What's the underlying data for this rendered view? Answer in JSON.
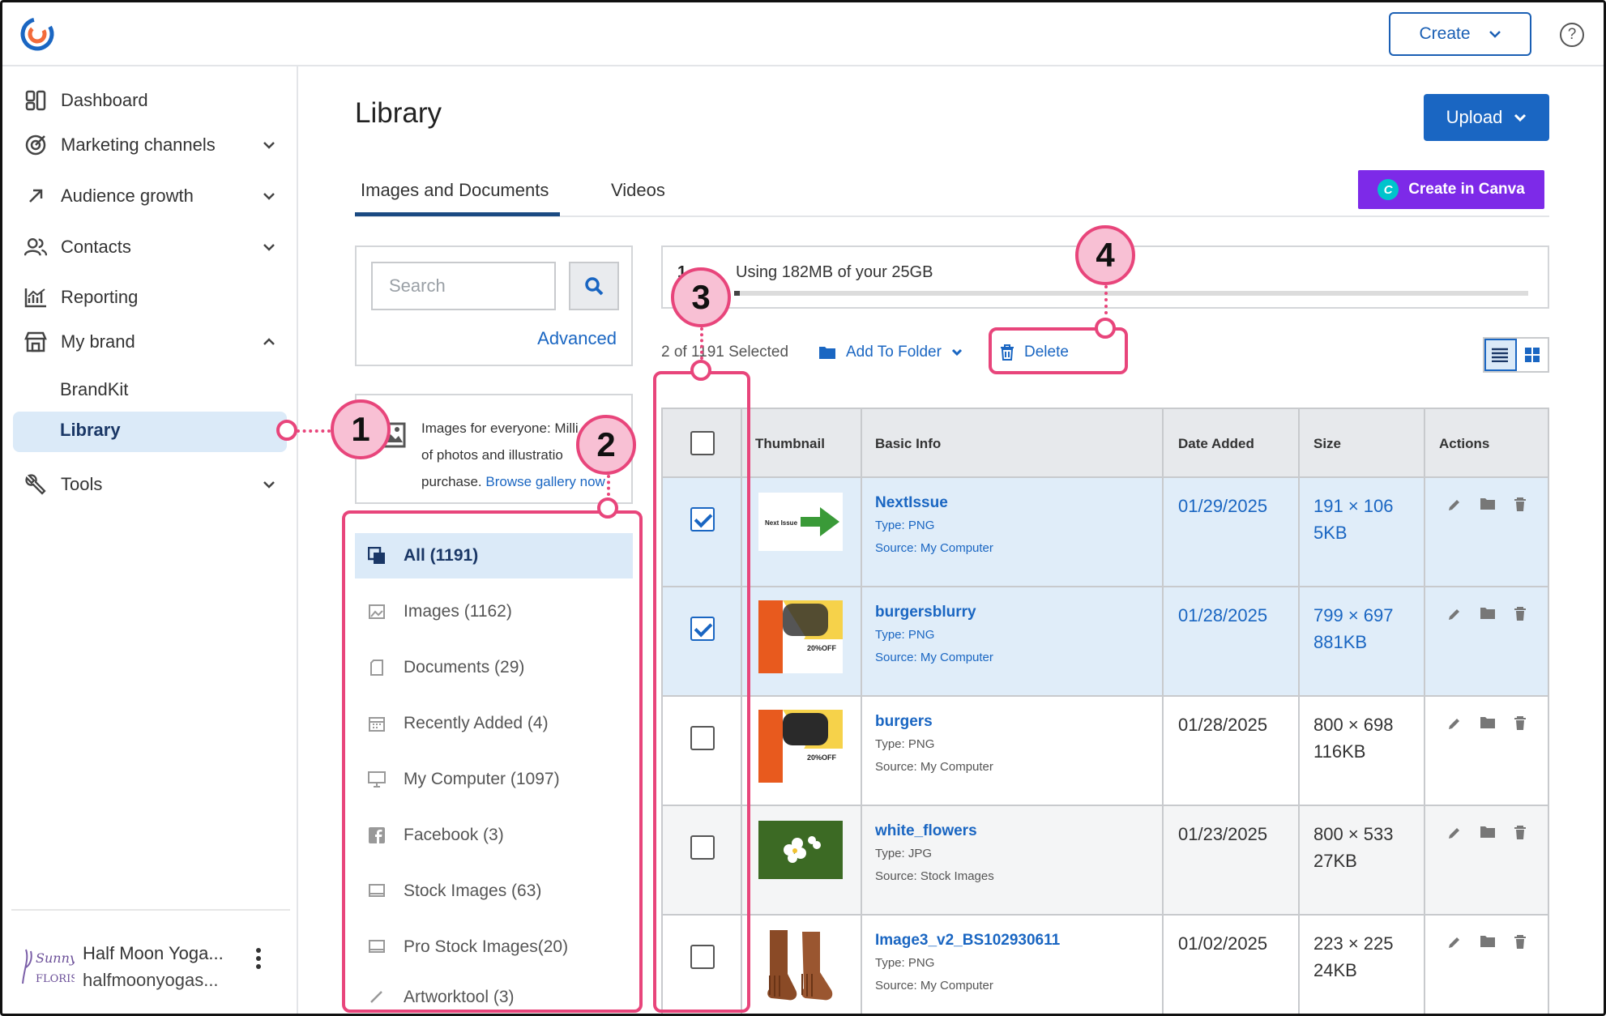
{
  "topbar": {
    "create_label": "Create",
    "help_symbol": "?"
  },
  "sidebar": {
    "items": [
      {
        "label": "Dashboard",
        "icon": "dashboard-icon"
      },
      {
        "label": "Marketing channels",
        "icon": "target-icon"
      },
      {
        "label": "Audience growth",
        "icon": "arrow-up-right-icon"
      },
      {
        "label": "Contacts",
        "icon": "people-icon"
      },
      {
        "label": "Reporting",
        "icon": "chart-icon"
      },
      {
        "label": "My brand",
        "icon": "store-icon"
      },
      {
        "label": "Tools",
        "icon": "wrench-icon"
      }
    ],
    "sub_items": [
      "BrandKit",
      "Library"
    ],
    "account": {
      "name": "Half Moon Yoga...",
      "email": "halfmoonyogas..."
    }
  },
  "page": {
    "title": "Library",
    "upload_label": "Upload",
    "canva_label": "Create in Canva",
    "tabs": [
      "Images and Documents",
      "Videos"
    ]
  },
  "search": {
    "placeholder": "Search",
    "advanced": "Advanced"
  },
  "promo": {
    "line1": "Images for everyone: Milli",
    "line2": "of photos and illustratio",
    "line3": "purchase.",
    "link": "Browse gallery now"
  },
  "filters": [
    {
      "label": "All (1191)",
      "icon": "all-files-icon"
    },
    {
      "label": "Images (1162)",
      "icon": "image-icon"
    },
    {
      "label": "Documents (29)",
      "icon": "document-icon"
    },
    {
      "label": "Recently Added (4)",
      "icon": "calendar-icon"
    },
    {
      "label": "My Computer (1097)",
      "icon": "monitor-icon"
    },
    {
      "label": "Facebook (3)",
      "icon": "facebook-icon"
    },
    {
      "label": "Stock Images (63)",
      "icon": "stock-icon"
    },
    {
      "label": "Pro Stock Images(20)",
      "icon": "stock-icon"
    },
    {
      "label": "Artworktool (3)",
      "icon": "brush-icon"
    }
  ],
  "storage": {
    "prefix": "1",
    "text": "Using 182MB of your 25GB",
    "used_fraction": 0.007
  },
  "toolbar": {
    "selected": "2 of 1191 Selected",
    "add_to_folder": "Add To Folder",
    "delete": "Delete"
  },
  "table": {
    "headers": [
      "Thumbnail",
      "Basic Info",
      "Date Added",
      "Size",
      "Actions"
    ],
    "rows": [
      {
        "name": "NextIssue",
        "type": "Type: PNG",
        "source": "Source: My Computer",
        "date": "01/29/2025",
        "dims": "191 × 106",
        "size": "5KB",
        "checked": true,
        "thumb_text": "Next Issue"
      },
      {
        "name": "burgersblurry",
        "type": "Type: PNG",
        "source": "Source: My Computer",
        "date": "01/28/2025",
        "dims": "799 × 697",
        "size": "881KB",
        "checked": true,
        "thumb_text": "20%OFF"
      },
      {
        "name": "burgers",
        "type": "Type: PNG",
        "source": "Source: My Computer",
        "date": "01/28/2025",
        "dims": "800 × 698",
        "size": "116KB",
        "checked": false,
        "thumb_text": "20%OFF"
      },
      {
        "name": "white_flowers",
        "type": "Type: JPG",
        "source": "Source: Stock Images",
        "date": "01/23/2025",
        "dims": "800 × 533",
        "size": "27KB",
        "checked": false,
        "thumb_text": ""
      },
      {
        "name": "Image3_v2_BS102930611",
        "type": "Type: PNG",
        "source": "Source: My Computer",
        "date": "01/02/2025",
        "dims": "223 × 225",
        "size": "24KB",
        "checked": false,
        "thumb_text": ""
      }
    ]
  },
  "callouts": [
    "1",
    "2",
    "3",
    "4"
  ],
  "colors": {
    "accent": "#1a66c2",
    "highlight": "#e8457b",
    "canva": "#7d2ae8"
  }
}
